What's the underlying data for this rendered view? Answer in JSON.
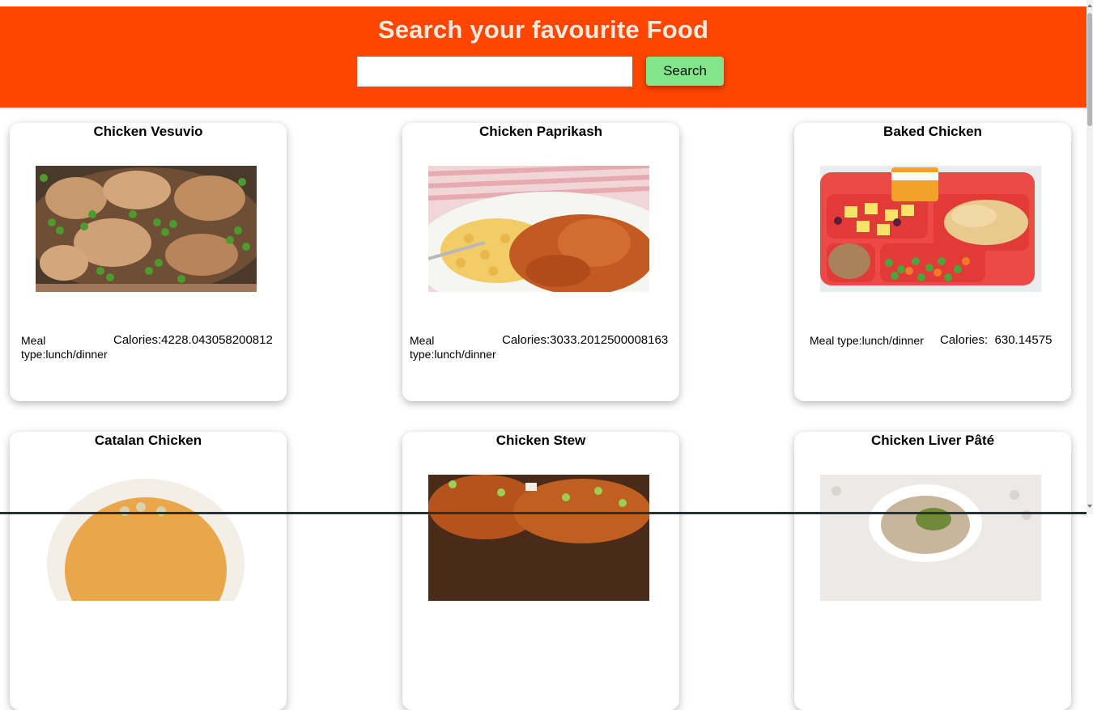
{
  "header": {
    "title": "Search your favourite Food",
    "search_placeholder": "",
    "search_value": "",
    "search_button_label": "Search"
  },
  "colors": {
    "header_bg": "#ff4500",
    "title_color": "#ffe9dc",
    "button_bg": "#82e58a"
  },
  "recipes": [
    {
      "title": "Chicken Vesuvio",
      "image_icon": "chicken-vesuvio-photo",
      "meal_type": "Meal type:lunch/dinner",
      "calories": "Calories:4228.043058200812"
    },
    {
      "title": "Chicken Paprikash",
      "image_icon": "chicken-paprikash-photo",
      "meal_type": "Meal type:lunch/dinner",
      "calories": "Calories:3033.2012500008163"
    },
    {
      "title": "Baked Chicken",
      "image_icon": "baked-chicken-photo",
      "meal_type": "Meal type:lunch/dinner",
      "calories": "Calories:  630.14575"
    },
    {
      "title": "Catalan Chicken",
      "image_icon": "catalan-chicken-photo"
    },
    {
      "title": "Chicken Stew",
      "image_icon": "chicken-stew-photo"
    },
    {
      "title": "Chicken Liver Pâté",
      "image_icon": "chicken-liver-pate-photo"
    }
  ]
}
